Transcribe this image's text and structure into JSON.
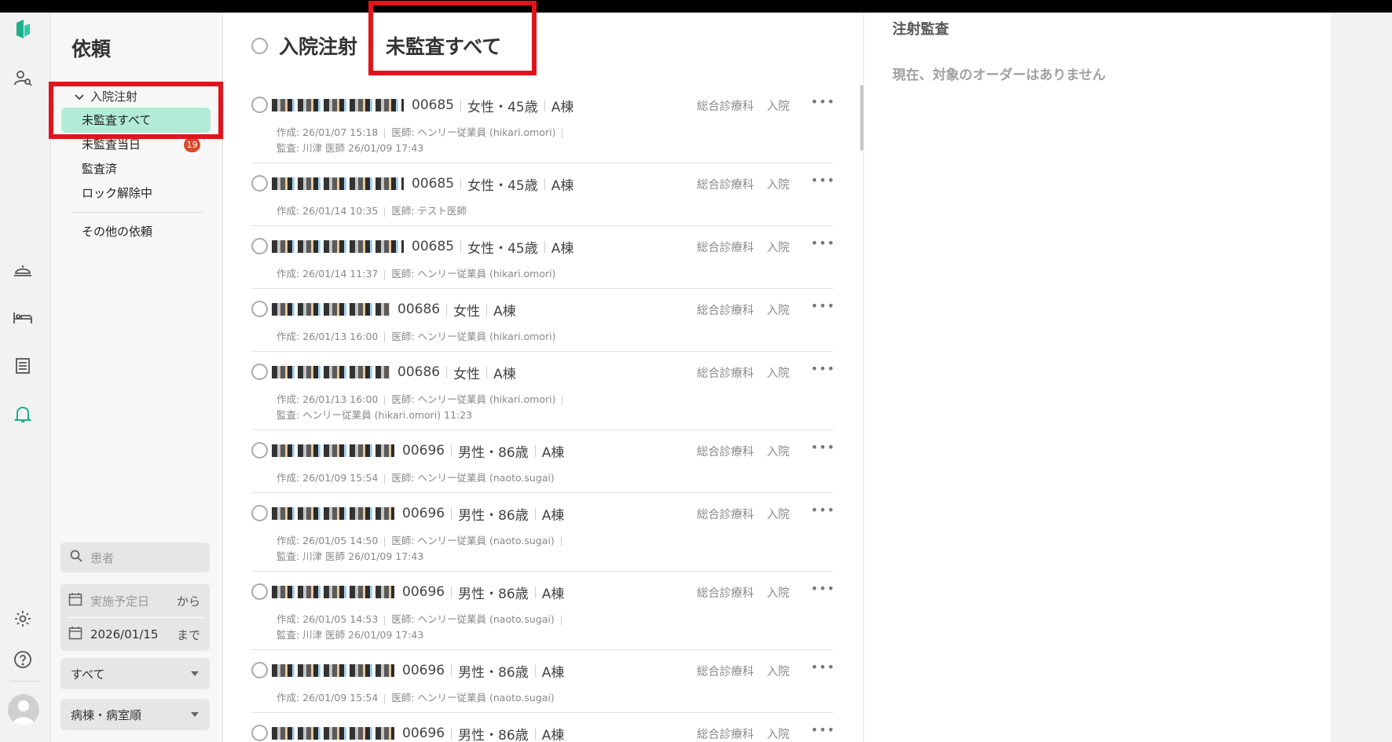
{
  "app": {
    "accent": "#1bb08a",
    "highlight_color": "#e0151b"
  },
  "rail": {
    "icons": [
      "logo-icon",
      "patient-search-icon",
      "meal-cloche-icon",
      "bed-icon",
      "document-list-icon",
      "bell-icon",
      "settings-icon",
      "help-icon",
      "avatar-icon"
    ]
  },
  "sidebar": {
    "title": "依頼",
    "group_label": "入院注射",
    "items": [
      {
        "label": "未監査すべて",
        "active": true
      },
      {
        "label": "未監査当日",
        "badge": "19"
      },
      {
        "label": "監査済"
      },
      {
        "label": "ロック解除中"
      }
    ],
    "other_label": "その他の依頼",
    "search_placeholder": "患者",
    "date_from_placeholder": "実施予定日",
    "date_from_suffix": "から",
    "date_to_value": "2026/01/15",
    "date_to_suffix": "まで",
    "filter_select": "すべて",
    "sort_select": "病棟・病室順"
  },
  "main": {
    "breadcrumb_root": "入院注射",
    "breadcrumb_current": "未監査すべて",
    "orders": [
      {
        "id": "00685",
        "sex_age": "女性・45歳",
        "ward": "A棟",
        "dept": "総合診療科",
        "kind": "入院",
        "created": "作成: 26/01/07 15:18",
        "doctor": "医師: ヘンリー従業員 (hikari.omori)",
        "audit": "監査: 川津 医師 26/01/09 17:43"
      },
      {
        "id": "00685",
        "sex_age": "女性・45歳",
        "ward": "A棟",
        "dept": "総合診療科",
        "kind": "入院",
        "created": "作成: 26/01/14 10:35",
        "doctor": "医師: テスト医師",
        "audit": ""
      },
      {
        "id": "00685",
        "sex_age": "女性・45歳",
        "ward": "A棟",
        "dept": "総合診療科",
        "kind": "入院",
        "created": "作成: 26/01/14 11:37",
        "doctor": "医師: ヘンリー従業員 (hikari.omori)",
        "audit": ""
      },
      {
        "id": "00686",
        "sex_age": "女性",
        "ward": "A棟",
        "dept": "総合診療科",
        "kind": "入院",
        "created": "作成: 26/01/13 16:00",
        "doctor": "医師: ヘンリー従業員 (hikari.omori)",
        "audit": ""
      },
      {
        "id": "00686",
        "sex_age": "女性",
        "ward": "A棟",
        "dept": "総合診療科",
        "kind": "入院",
        "created": "作成: 26/01/13 16:00",
        "doctor": "医師: ヘンリー従業員 (hikari.omori)",
        "audit": "監査: ヘンリー従業員 (hikari.omori) 11:23"
      },
      {
        "id": "00696",
        "sex_age": "男性・86歳",
        "ward": "A棟",
        "dept": "総合診療科",
        "kind": "入院",
        "created": "作成: 26/01/09 15:54",
        "doctor": "医師: ヘンリー従業員 (naoto.sugai)",
        "audit": ""
      },
      {
        "id": "00696",
        "sex_age": "男性・86歳",
        "ward": "A棟",
        "dept": "総合診療科",
        "kind": "入院",
        "created": "作成: 26/01/05 14:50",
        "doctor": "医師: ヘンリー従業員 (naoto.sugai)",
        "audit": "監査: 川津 医師 26/01/09 17:43"
      },
      {
        "id": "00696",
        "sex_age": "男性・86歳",
        "ward": "A棟",
        "dept": "総合診療科",
        "kind": "入院",
        "created": "作成: 26/01/05 14:53",
        "doctor": "医師: ヘンリー従業員 (naoto.sugai)",
        "audit": "監査: 川津 医師 26/01/09 17:43"
      },
      {
        "id": "00696",
        "sex_age": "男性・86歳",
        "ward": "A棟",
        "dept": "総合診療科",
        "kind": "入院",
        "created": "作成: 26/01/09 15:54",
        "doctor": "医師: ヘンリー従業員 (naoto.sugai)",
        "audit": ""
      },
      {
        "id": "00696",
        "sex_age": "男性・86歳",
        "ward": "A棟",
        "dept": "総合診療科",
        "kind": "入院",
        "created": "",
        "doctor": "",
        "audit": ""
      }
    ]
  },
  "panel": {
    "title": "注射監査",
    "empty_message": "現在、対象のオーダーはありません"
  }
}
